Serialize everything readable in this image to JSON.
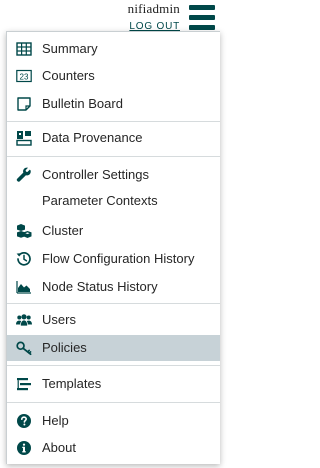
{
  "header": {
    "username": "nifiadmin",
    "logout_label": "LOG OUT"
  },
  "menu": {
    "items": [
      {
        "label": "Summary",
        "icon": "table-icon"
      },
      {
        "label": "Counters",
        "icon": "counter-icon"
      },
      {
        "label": "Bulletin Board",
        "icon": "sticky-note-icon"
      },
      {
        "label": "Data Provenance",
        "icon": "provenance-icon"
      },
      {
        "label": "Controller Settings",
        "icon": "wrench-icon"
      },
      {
        "label": "Parameter Contexts",
        "icon": ""
      },
      {
        "label": "Cluster",
        "icon": "cubes-icon"
      },
      {
        "label": "Flow Configuration History",
        "icon": "history-icon"
      },
      {
        "label": "Node Status History",
        "icon": "area-chart-icon"
      },
      {
        "label": "Users",
        "icon": "users-icon"
      },
      {
        "label": "Policies",
        "icon": "key-icon",
        "active": true
      },
      {
        "label": "Templates",
        "icon": "templates-icon"
      },
      {
        "label": "Help",
        "icon": "question-circle-icon"
      },
      {
        "label": "About",
        "icon": "info-circle-icon"
      }
    ]
  },
  "colors": {
    "icon": "#004849",
    "active_background": "#c7d2d7",
    "separator": "#d6dbdd"
  }
}
